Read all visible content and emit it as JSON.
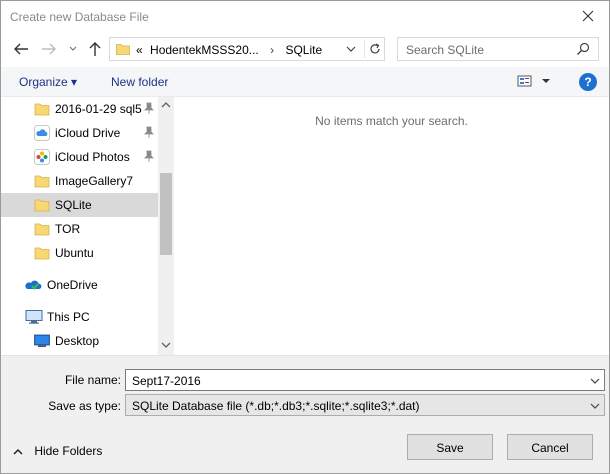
{
  "window": {
    "title": "Create new Database File"
  },
  "address": {
    "prefix": "«",
    "path": [
      "HodentekMSSS20...",
      "SQLite"
    ]
  },
  "search": {
    "placeholder": "Search SQLite"
  },
  "toolbar": {
    "organize_label": "Organize ▾",
    "new_folder_label": "New folder",
    "help_label": "?"
  },
  "nav_items": [
    {
      "label": "2016-01-29 sql5",
      "icon": "folder-icon",
      "pinned": true
    },
    {
      "label": "iCloud Drive",
      "icon": "icloud-drive-icon",
      "pinned": true
    },
    {
      "label": "iCloud Photos",
      "icon": "icloud-photos-icon",
      "pinned": true
    },
    {
      "label": "ImageGallery7",
      "icon": "folder-icon",
      "pinned": false
    },
    {
      "label": "SQLite",
      "icon": "folder-icon",
      "pinned": false,
      "selected": true
    },
    {
      "label": "TOR",
      "icon": "folder-icon",
      "pinned": false
    },
    {
      "label": "Ubuntu",
      "icon": "folder-icon",
      "pinned": false
    },
    {
      "label": "OneDrive",
      "icon": "onedrive-icon",
      "pinned": false
    },
    {
      "label": "This PC",
      "icon": "this-pc-icon",
      "pinned": false
    },
    {
      "label": "Desktop",
      "icon": "desktop-icon",
      "pinned": false
    }
  ],
  "content": {
    "empty_message": "No items match your search."
  },
  "form": {
    "file_name_label": "File name:",
    "file_name_value": "Sept17-2016",
    "save_type_label": "Save as type:",
    "save_type_value": "SQLite Database file (*.db;*.db3;*.sqlite;*.sqlite3;*.dat)"
  },
  "footer": {
    "hide_folders_label": "Hide Folders",
    "save_label": "Save",
    "cancel_label": "Cancel"
  },
  "colors": {
    "link_blue": "#1e3287",
    "folder_yellow": "#f8d775",
    "selection_gray": "#d9d9d9",
    "help_blue": "#1f6fd1"
  }
}
